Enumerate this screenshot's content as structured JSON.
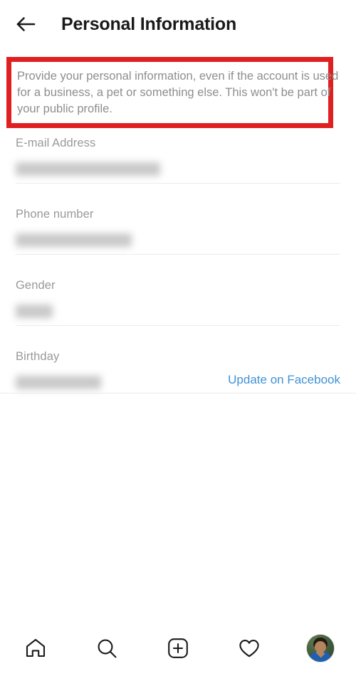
{
  "header": {
    "back_icon": "arrow-left-icon",
    "title": "Personal Information"
  },
  "description": {
    "text": "Provide your personal information, even if the account is used for a business, a pet or something else. This won't be part of your public profile.",
    "annotation_color": "#E02020",
    "text_color": "#8e8e8e"
  },
  "fields": [
    {
      "label": "E-mail Address",
      "value": "",
      "value_redacted": true,
      "action_label": ""
    },
    {
      "label": "Phone number",
      "value": "",
      "value_redacted": true,
      "action_label": ""
    },
    {
      "label": "Gender",
      "value": "",
      "value_redacted": true,
      "action_label": ""
    },
    {
      "label": "Birthday",
      "value": "",
      "value_redacted": true,
      "action_label": "Update on Facebook"
    }
  ],
  "theme": {
    "link_color": "#3f91d4",
    "label_color": "#999999",
    "divider_color": "#ececec",
    "background": "#ffffff"
  },
  "bottom_nav": {
    "items": [
      {
        "name": "home-icon",
        "label": "Home"
      },
      {
        "name": "search-icon",
        "label": "Search"
      },
      {
        "name": "add-post-icon",
        "label": "Create"
      },
      {
        "name": "heart-icon",
        "label": "Activity"
      },
      {
        "name": "avatar",
        "label": "Profile"
      }
    ]
  }
}
